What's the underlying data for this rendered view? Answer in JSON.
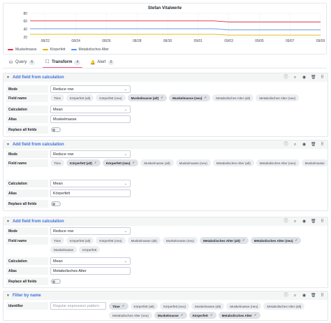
{
  "chart": {
    "title": "Stefan Vitalwerte",
    "yticks": [
      "80",
      "60",
      "40",
      "20"
    ],
    "xticks": [
      "08/22",
      "08/24",
      "08/26",
      "08/28",
      "08/30",
      "09/01",
      "09/03",
      "09/05",
      "09/07",
      "09/09"
    ],
    "legend": [
      {
        "name": "Muskelmasse",
        "color": "#e02f44"
      },
      {
        "name": "Körperfett",
        "color": "#e0b400"
      },
      {
        "name": "Metabolisches Alter",
        "color": "#5794f2"
      }
    ]
  },
  "chart_data": {
    "type": "line",
    "title": "Stefan Vitalwerte",
    "x": [
      "08/21",
      "08/22",
      "08/23",
      "08/24",
      "08/25",
      "08/26",
      "08/27",
      "08/28",
      "08/29",
      "08/30",
      "08/31",
      "09/01",
      "09/02",
      "09/03",
      "09/04",
      "09/05",
      "09/06",
      "09/07",
      "09/08",
      "09/09"
    ],
    "xticks": [
      "08/22",
      "08/24",
      "08/26",
      "08/28",
      "08/30",
      "09/01",
      "09/03",
      "09/05",
      "09/07",
      "09/09"
    ],
    "ylim": [
      20,
      80
    ],
    "yticks": [
      80,
      60,
      40,
      20
    ],
    "grid": true,
    "legend_position": "bottom-left",
    "series": [
      {
        "name": "Muskelmasse",
        "color": "#e02f44",
        "values": [
          61,
          61,
          61,
          61,
          61,
          61,
          61,
          61,
          61,
          61,
          61,
          61,
          61,
          58,
          58,
          58,
          58,
          58,
          58,
          58
        ]
      },
      {
        "name": "Körperfett",
        "color": "#e0b400",
        "values": [
          27,
          27,
          27,
          27,
          27,
          27,
          27,
          27,
          27,
          27,
          27,
          27,
          27,
          25,
          25,
          25,
          25,
          25,
          25,
          25
        ]
      },
      {
        "name": "Metabolisches Alter",
        "color": "#5794f2",
        "values": [
          41,
          41,
          41,
          41,
          41,
          41,
          41,
          41,
          41,
          41,
          41,
          41,
          41,
          38,
          38,
          38,
          38,
          38,
          38,
          38
        ]
      }
    ]
  },
  "tabs": [
    {
      "label": "Query",
      "count": "6",
      "icon": "database-icon"
    },
    {
      "label": "Transform",
      "count": "4",
      "icon": "transform-icon",
      "active": true
    },
    {
      "label": "Alert",
      "count": "0",
      "icon": "bell-icon"
    }
  ],
  "cards": [
    {
      "title": "Add field from calculation",
      "mode_label": "Mode",
      "mode_value": "Reduce row",
      "fieldname_label": "Field name",
      "chips": [
        {
          "label": "Time",
          "selected": false
        },
        {
          "label": "Körperfett (alt)",
          "selected": false
        },
        {
          "label": "Körperfett (neu)",
          "selected": false
        },
        {
          "label": "Muskelmasse (alt)",
          "selected": true
        },
        {
          "label": "Muskelmasse (neu)",
          "selected": true
        },
        {
          "label": "Metabolisches Alter (alt)",
          "selected": false
        },
        {
          "label": "Metabolisches Alter (neu)",
          "selected": false
        }
      ],
      "calc_label": "Calculation",
      "calc_value": "Mean",
      "alias_label": "Alias",
      "alias_value": "Muskelmasse",
      "replace_label": "Replace all fields"
    },
    {
      "title": "Add field from calculation",
      "mode_label": "Mode",
      "mode_value": "Reduce row",
      "fieldname_label": "Field name",
      "chips": [
        {
          "label": "Time",
          "selected": false
        },
        {
          "label": "Körperfett (alt)",
          "selected": true
        },
        {
          "label": "Körperfett (neu)",
          "selected": true
        },
        {
          "label": "Muskelmasse (alt)",
          "selected": false
        },
        {
          "label": "Muskelmasse (neu)",
          "selected": false
        },
        {
          "label": "Metabolisches Alter (alt)",
          "selected": false
        },
        {
          "label": "Metabolisches Alter (neu)",
          "selected": false
        },
        {
          "label": "Muskelmasse",
          "selected": false
        }
      ],
      "calc_label": "Calculation",
      "calc_value": "Mean",
      "alias_label": "Alias",
      "alias_value": "Körperfett",
      "replace_label": "Replace all fields"
    },
    {
      "title": "Add field from calculation",
      "mode_label": "Mode",
      "mode_value": "Reduce row",
      "fieldname_label": "Field name",
      "chips": [
        {
          "label": "Time",
          "selected": false
        },
        {
          "label": "Körperfett (alt)",
          "selected": false
        },
        {
          "label": "Körperfett (neu)",
          "selected": false
        },
        {
          "label": "Muskelmasse (alt)",
          "selected": false
        },
        {
          "label": "Muskelmasse (neu)",
          "selected": false
        },
        {
          "label": "Metabolisches Alter (alt)",
          "selected": true
        },
        {
          "label": "Metabolisches Alter (neu)",
          "selected": true
        },
        {
          "label": "Muskelmasse",
          "selected": false
        },
        {
          "label": "Körperfett",
          "selected": false
        }
      ],
      "calc_label": "Calculation",
      "calc_value": "Mean",
      "alias_label": "Alias",
      "alias_value": "Metabolisches Alter",
      "replace_label": "Replace all fields"
    }
  ],
  "filter": {
    "title": "Filter by name",
    "identifier_label": "Identifier",
    "placeholder": "Regular expression pattern",
    "chips": [
      {
        "label": "Time",
        "selected": true
      },
      {
        "label": "Körperfett (alt)",
        "selected": false
      },
      {
        "label": "Körperfett (neu)",
        "selected": false
      },
      {
        "label": "Muskelmasse (alt)",
        "selected": false
      },
      {
        "label": "Muskelmasse (neu)",
        "selected": false
      },
      {
        "label": "Metabolisches Alter (alt)",
        "selected": false
      },
      {
        "label": "Metabolisches Alter (neu)",
        "selected": false
      },
      {
        "label": "Muskelmasse",
        "selected": true
      },
      {
        "label": "Körperfett",
        "selected": true
      },
      {
        "label": "Metabolisches Alter",
        "selected": true
      }
    ]
  },
  "icons": {
    "info": "info-icon",
    "debug": "debug-icon",
    "toggle": "eye-icon",
    "delete": "trash-icon",
    "drag": "drag-handle-icon"
  }
}
